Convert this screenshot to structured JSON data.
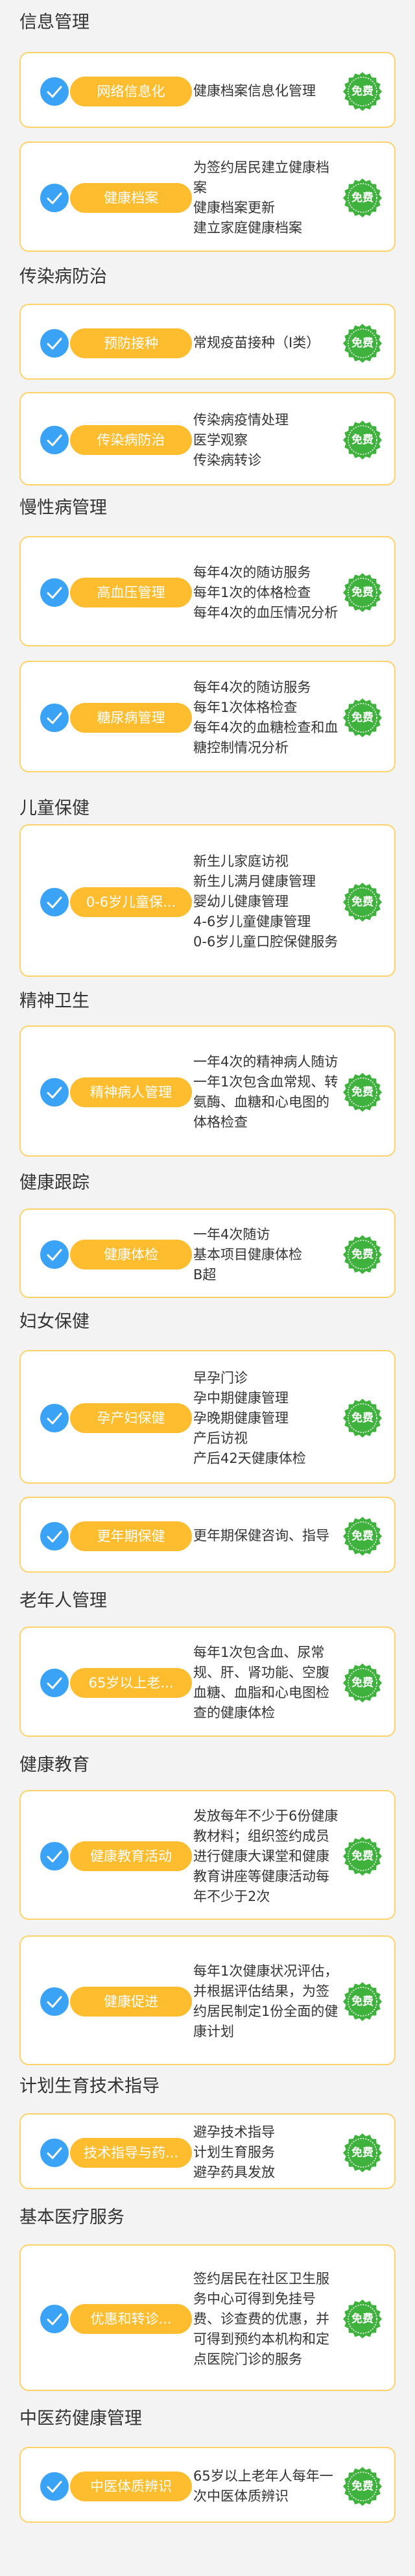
{
  "badge_label": "免费",
  "colors": {
    "accent": "#fdbd2f",
    "border": "#ffd36a",
    "check": "#3aa3f5",
    "badge": "#3fb23d"
  },
  "sections": [
    {
      "title": "信息管理",
      "items": [
        {
          "pill": "网络信息化",
          "desc": "健康档案信息化管理"
        },
        {
          "pill": "健康档案",
          "desc": "为签约居民建立健康档案\n健康档案更新\n建立家庭健康档案"
        }
      ]
    },
    {
      "title": "传染病防治",
      "items": [
        {
          "pill": "预防接种",
          "desc": "常规疫苗接种（Ⅰ类）"
        },
        {
          "pill": "传染病防治",
          "desc": "传染病疫情处理\n医学观察\n传染病转诊"
        }
      ]
    },
    {
      "title": "慢性病管理",
      "items": [
        {
          "pill": "高血压管理",
          "desc": "每年4次的随访服务\n每年1次的体格检查\n每年4次的血压情况分析"
        },
        {
          "pill": "糖尿病管理",
          "desc": "每年4次的随访服务\n每年1次体格检查\n每年4次的血糖检查和血糖控制情况分析"
        }
      ]
    },
    {
      "title": "儿童保健",
      "items": [
        {
          "pill": "0-6岁儿童保...",
          "desc": "新生儿家庭访视\n新生儿满月健康管理\n婴幼儿健康管理\n4-6岁儿童健康管理\n0-6岁儿童口腔保健服务"
        }
      ]
    },
    {
      "title": "精神卫生",
      "items": [
        {
          "pill": "精神病人管理",
          "desc": "一年4次的精神病人随访\n一年1次包含血常规、转氨酶、血糖和心电图的体格检查"
        }
      ]
    },
    {
      "title": "健康跟踪",
      "items": [
        {
          "pill": "健康体检",
          "desc": "一年4次随访\n基本项目健康体检\nB超"
        }
      ]
    },
    {
      "title": "妇女保健",
      "items": [
        {
          "pill": "孕产妇保健",
          "desc": "早孕门诊\n孕中期健康管理\n孕晚期健康管理\n产后访视\n产后42天健康体检"
        },
        {
          "pill": "更年期保健",
          "desc": "更年期保健咨询、指导"
        }
      ]
    },
    {
      "title": "老年人管理",
      "items": [
        {
          "pill": "65岁以上老...",
          "desc": "每年1次包含血、尿常规、肝、肾功能、空腹血糖、血脂和心电图检查的健康体检"
        }
      ]
    },
    {
      "title": "健康教育",
      "items": [
        {
          "pill": "健康教育活动",
          "desc": "发放每年不少于6份健康教材料；组织签约成员进行健康大课堂和健康教育讲座等健康活动每年不少于2次"
        },
        {
          "pill": "健康促进",
          "desc": "每年1次健康状况评估，并根据评估结果，为签约居民制定1份全面的健康计划"
        }
      ]
    },
    {
      "title": "计划生育技术指导",
      "items": [
        {
          "pill": "技术指导与药...",
          "desc": " 避孕技术指导\n 计划生育服务\n 避孕药具发放"
        }
      ]
    },
    {
      "title": "基本医疗服务",
      "items": [
        {
          "pill": "优惠和转诊...",
          "desc": "签约居民在社区卫生服务中心可得到免挂号费、诊查费的优惠，并可得到预约本机构和定点医院门诊的服务"
        }
      ]
    },
    {
      "title": "中医药健康管理",
      "items": [
        {
          "pill": "中医体质辨识",
          "desc": "65岁以上老年人每年一次中医体质辨识"
        }
      ]
    }
  ]
}
